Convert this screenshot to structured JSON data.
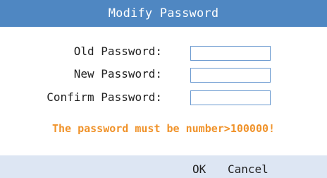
{
  "dialog": {
    "title": "Modify Password",
    "fields": {
      "old_password": {
        "label": "Old Password:",
        "value": ""
      },
      "new_password": {
        "label": "New Password:",
        "value": ""
      },
      "confirm_password": {
        "label": "Confirm Password:",
        "value": ""
      }
    },
    "hint": "The password must be number>100000!",
    "buttons": {
      "ok": "OK",
      "cancel": "Cancel"
    }
  },
  "colors": {
    "title_bar": "#4f87c2",
    "hint_text": "#f0932b",
    "footer_bg": "#dde6f3",
    "field_border": "#6b9ad0"
  }
}
